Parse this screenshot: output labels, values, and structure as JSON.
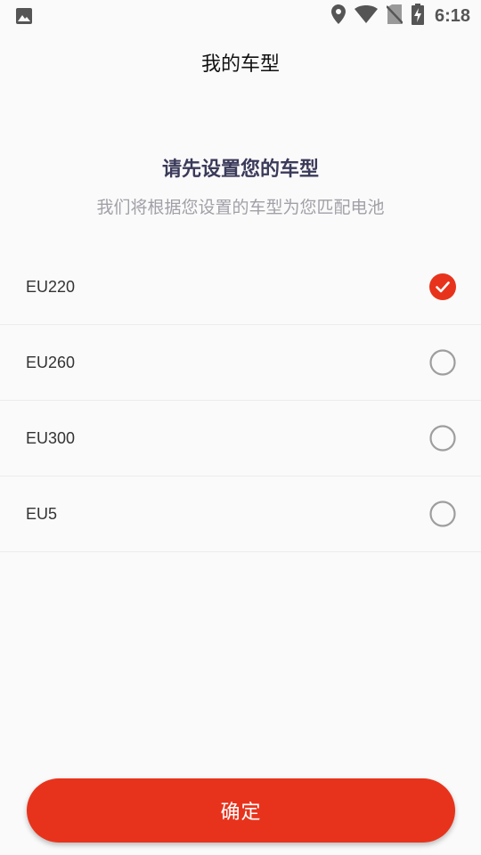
{
  "status_bar": {
    "time": "6:18",
    "icons": [
      "image-icon",
      "location-icon",
      "wifi-icon",
      "no-sim-icon",
      "battery-charging-icon"
    ]
  },
  "header": {
    "title": "我的车型"
  },
  "intro": {
    "heading": "请先设置您的车型",
    "subtitle": "我们将根据您设置的车型为您匹配电池"
  },
  "models": [
    {
      "label": "EU220",
      "selected": true
    },
    {
      "label": "EU260",
      "selected": false
    },
    {
      "label": "EU300",
      "selected": false
    },
    {
      "label": "EU5",
      "selected": false
    }
  ],
  "confirm": {
    "label": "确定"
  },
  "colors": {
    "accent": "#e8331c",
    "background": "#fafafa",
    "heading": "#3a3a5a",
    "subtitle": "#a0a0a8",
    "radio_unselected": "#9e9e9e"
  }
}
